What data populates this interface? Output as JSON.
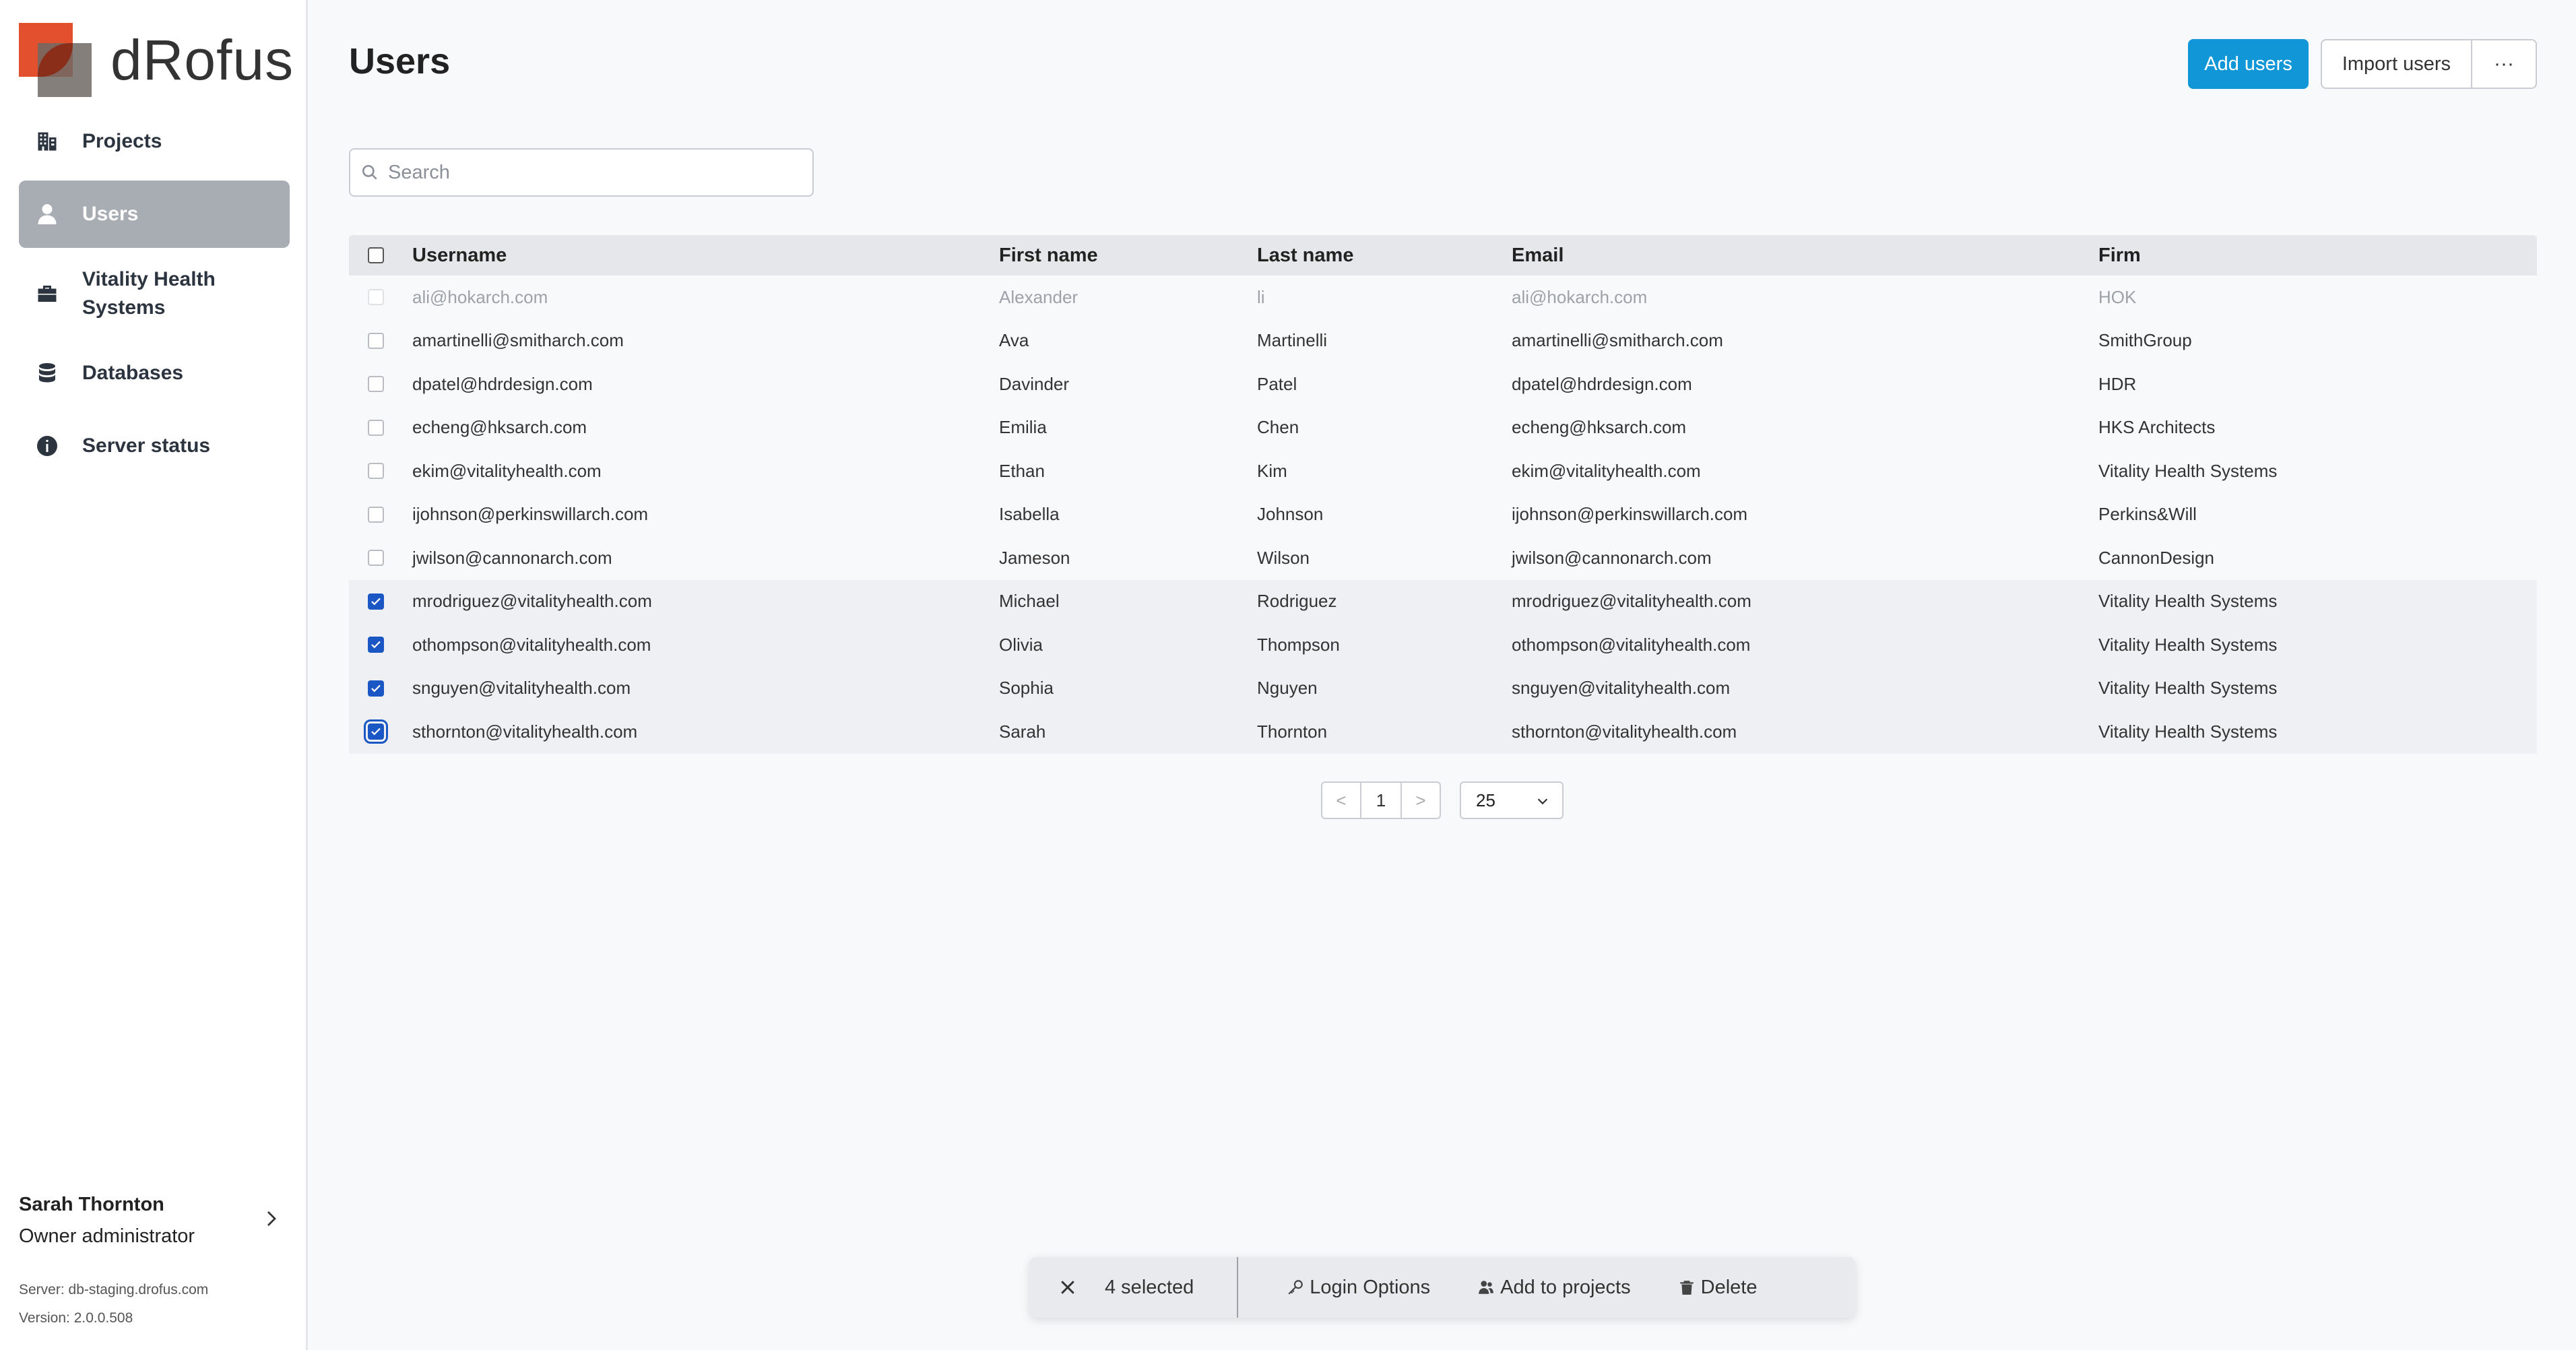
{
  "brand": {
    "name": "dRofus"
  },
  "sidebar": {
    "items": [
      {
        "label": "Projects",
        "icon": "building-icon"
      },
      {
        "label": "Users",
        "icon": "user-icon",
        "active": true
      },
      {
        "label": "Vitality Health Systems",
        "icon": "briefcase-icon"
      },
      {
        "label": "Databases",
        "icon": "database-icon"
      },
      {
        "label": "Server status",
        "icon": "info-icon"
      }
    ],
    "user": {
      "name": "Sarah Thornton",
      "role": "Owner administrator"
    },
    "server": "Server: db-staging.drofus.com",
    "version": "Version: 2.0.0.508"
  },
  "page": {
    "title": "Users",
    "add_users": "Add users",
    "import_users": "Import users",
    "more": "···"
  },
  "search": {
    "placeholder": "Search",
    "value": ""
  },
  "table": {
    "columns": [
      "Username",
      "First name",
      "Last name",
      "Email",
      "Firm"
    ],
    "rows": [
      {
        "username": "ali@hokarch.com",
        "first": "Alexander",
        "last": "li",
        "email": "ali@hokarch.com",
        "firm": "HOK",
        "checked": false,
        "disabled": true
      },
      {
        "username": "amartinelli@smitharch.com",
        "first": "Ava",
        "last": "Martinelli",
        "email": "amartinelli@smitharch.com",
        "firm": "SmithGroup",
        "checked": false
      },
      {
        "username": "dpatel@hdrdesign.com",
        "first": "Davinder",
        "last": "Patel",
        "email": "dpatel@hdrdesign.com",
        "firm": "HDR",
        "checked": false
      },
      {
        "username": "echeng@hksarch.com",
        "first": "Emilia",
        "last": "Chen",
        "email": "echeng@hksarch.com",
        "firm": "HKS Architects",
        "checked": false
      },
      {
        "username": "ekim@vitalityhealth.com",
        "first": "Ethan",
        "last": "Kim",
        "email": "ekim@vitalityhealth.com",
        "firm": "Vitality Health Systems",
        "checked": false
      },
      {
        "username": "ijohnson@perkinswillarch.com",
        "first": "Isabella",
        "last": "Johnson",
        "email": "ijohnson@perkinswillarch.com",
        "firm": "Perkins&Will",
        "checked": false
      },
      {
        "username": "jwilson@cannonarch.com",
        "first": "Jameson",
        "last": "Wilson",
        "email": "jwilson@cannonarch.com",
        "firm": "CannonDesign",
        "checked": false
      },
      {
        "username": "mrodriguez@vitalityhealth.com",
        "first": "Michael",
        "last": "Rodriguez",
        "email": "mrodriguez@vitalityhealth.com",
        "firm": "Vitality Health Systems",
        "checked": true
      },
      {
        "username": "othompson@vitalityhealth.com",
        "first": "Olivia",
        "last": "Thompson",
        "email": "othompson@vitalityhealth.com",
        "firm": "Vitality Health Systems",
        "checked": true
      },
      {
        "username": "snguyen@vitalityhealth.com",
        "first": "Sophia",
        "last": "Nguyen",
        "email": "snguyen@vitalityhealth.com",
        "firm": "Vitality Health Systems",
        "checked": true
      },
      {
        "username": "sthornton@vitalityhealth.com",
        "first": "Sarah",
        "last": "Thornton",
        "email": "sthornton@vitalityhealth.com",
        "firm": "Vitality Health Systems",
        "checked": true,
        "focused": true
      }
    ]
  },
  "pagination": {
    "prev": "<",
    "page": "1",
    "next": ">",
    "page_size": "25"
  },
  "action_bar": {
    "selected": "4 selected",
    "login_options": "Login Options",
    "add_to_projects": "Add to projects",
    "delete": "Delete"
  },
  "colors": {
    "accent": "#1197d8",
    "checkbox": "#1a56c4",
    "brand_red": "#e2502e"
  }
}
